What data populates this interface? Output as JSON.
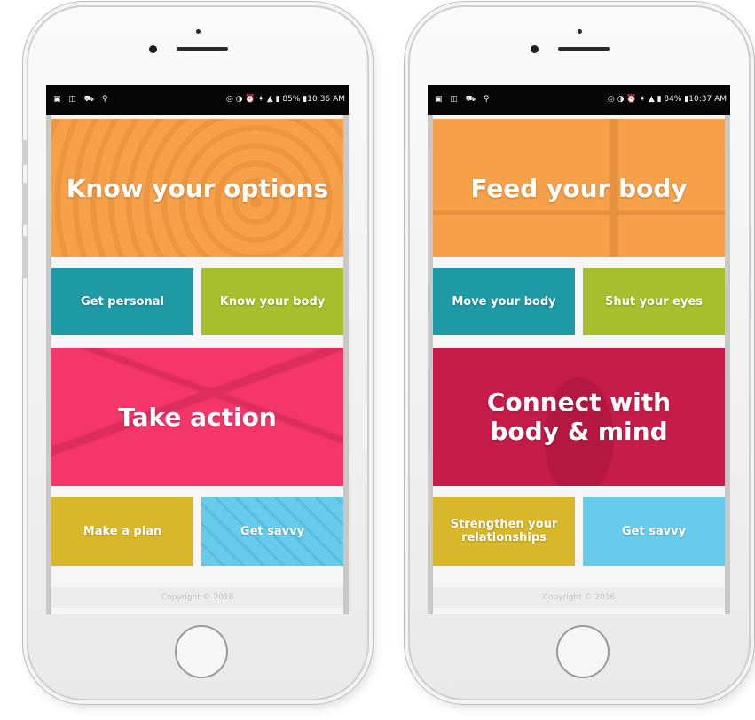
{
  "phones": [
    {
      "status": {
        "time": "10:36 AM",
        "battery": "85%"
      },
      "tiles": {
        "top": "Know your options",
        "row1_left": "Get personal",
        "row1_right": "Know your body",
        "middle": "Take action",
        "row2_left": "Make a plan",
        "row2_right": "Get savvy"
      },
      "footer": "Copyright © 2016"
    },
    {
      "status": {
        "time": "10:37 AM",
        "battery": "84%"
      },
      "tiles": {
        "top": "Feed your body",
        "row1_left": "Move your body",
        "row1_right": "Shut your eyes",
        "middle_line1": "Connect with",
        "middle_line2": "body & mind",
        "row2_left_line1": "Strengthen your",
        "row2_left_line2": "relationships",
        "row2_right": "Get savvy"
      },
      "footer": "Copyright © 2016"
    }
  ],
  "colors": {
    "orange": "#F7A04A",
    "teal": "#1E9AA7",
    "lime": "#A7BF2C",
    "pink": "#F5366A",
    "crimson": "#C51C4A",
    "mustard": "#D8B82A",
    "sky": "#67CCEC"
  },
  "icons": [
    "photo-icon",
    "message-icon",
    "car-icon",
    "usb-icon",
    "nfc-icon",
    "vibrate-icon",
    "alarm-icon",
    "wifi-icon",
    "signal-icon",
    "battery-icon"
  ]
}
